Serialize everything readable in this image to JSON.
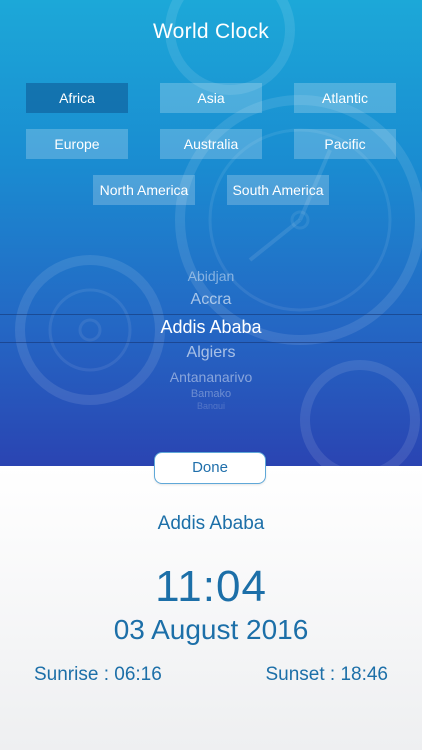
{
  "header": {
    "title": "World Clock"
  },
  "regions": [
    {
      "label": "Africa",
      "selected": true
    },
    {
      "label": "Asia",
      "selected": false
    },
    {
      "label": "Atlantic",
      "selected": false
    },
    {
      "label": "Europe",
      "selected": false
    },
    {
      "label": "Australia",
      "selected": false
    },
    {
      "label": "Pacific",
      "selected": false
    },
    {
      "label": "North America",
      "selected": false
    },
    {
      "label": "South America",
      "selected": false
    }
  ],
  "picker": {
    "items": [
      "Abidjan",
      "Accra",
      "Addis Ababa",
      "Algiers",
      "Antananarivo",
      "Bamako",
      "Bangui"
    ],
    "selected": "Addis Ababa"
  },
  "done_label": "Done",
  "clock": {
    "city": "Addis Ababa",
    "time": "11:04",
    "date": "03 August 2016",
    "sunrise": "Sunrise : 06:16",
    "sunset": "Sunset : 18:46"
  },
  "colors": {
    "accent": "#1c6fa8",
    "header_top": "#1ca8d8",
    "header_bottom": "#2a44b2"
  }
}
